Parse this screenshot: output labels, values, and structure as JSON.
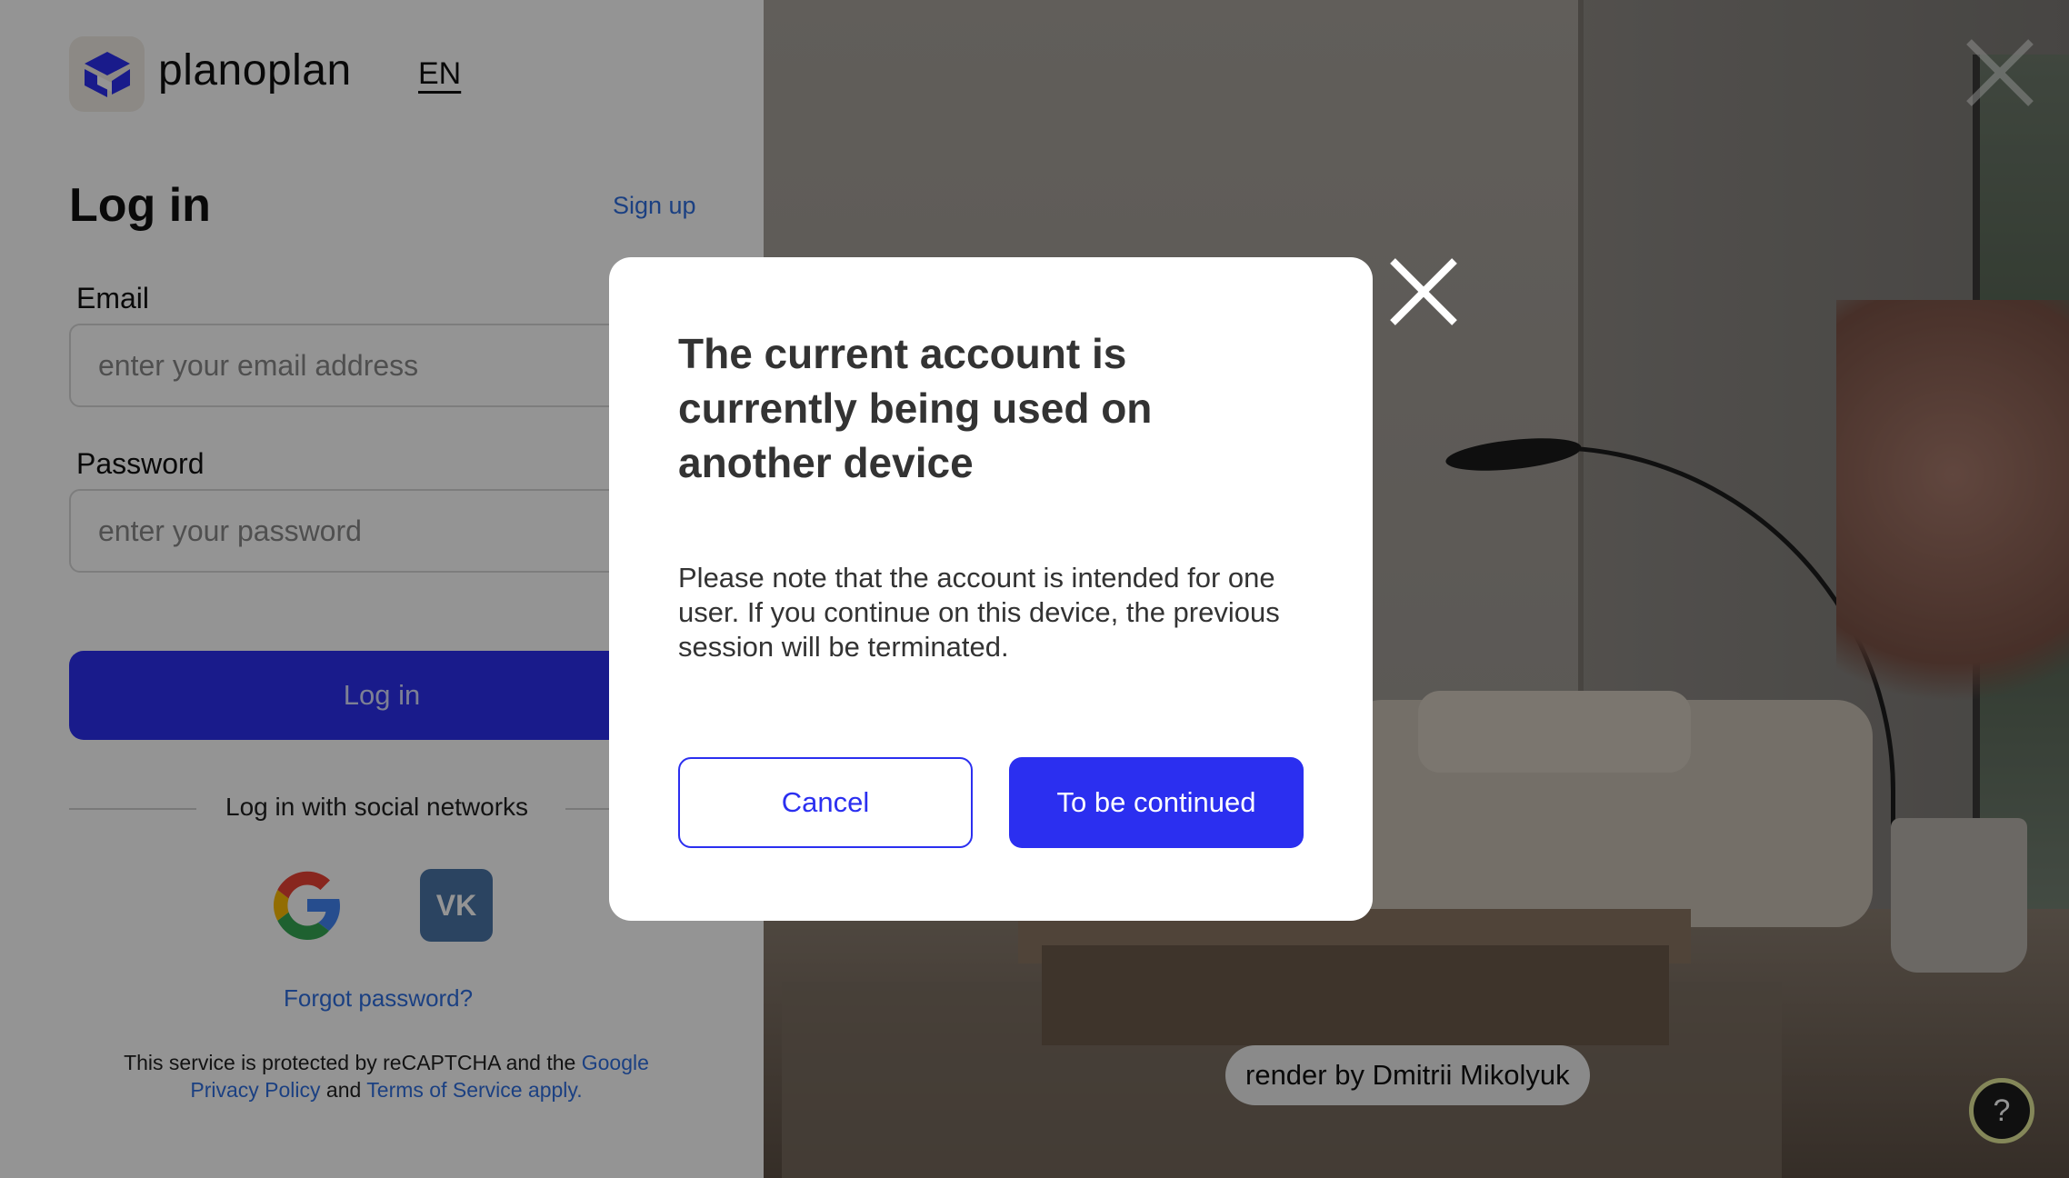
{
  "login": {
    "brand": "planoplan",
    "language": "EN",
    "title": "Log in",
    "signup_link": "Sign up",
    "email_label": "Email",
    "email_placeholder": "enter your email address",
    "password_label": "Password",
    "password_placeholder": "enter your password",
    "login_button": "Log in",
    "social_heading": "Log in with social networks",
    "social_providers": [
      "google",
      "vk"
    ],
    "forgot_password": "Forgot password?",
    "captcha_text_1": "This service is protected by reCAPTCHA and the",
    "captcha_link_1a": "Google",
    "captcha_link_1b": "Privacy Policy",
    "captcha_and": "and",
    "captcha_link_2": "Terms of Service apply."
  },
  "photo": {
    "credit": "render by Dmitrii Mikolyuk",
    "help_label": "?"
  },
  "modal": {
    "title": "The current account is currently being used on another device",
    "body": "Please note that the account is intended for one user. If you continue on this device, the previous session will be terminated.",
    "cancel_button": "Cancel",
    "continue_button": "To be continued"
  },
  "colors": {
    "accent": "#2b2ff0",
    "link": "#2f6fe0",
    "vk": "#4a76a8"
  }
}
